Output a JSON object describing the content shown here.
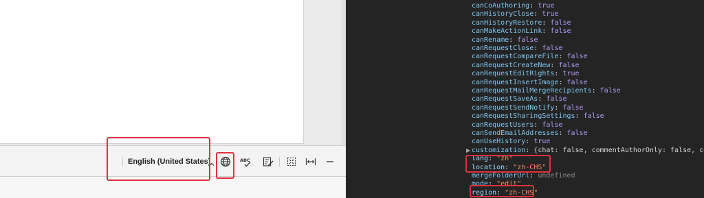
{
  "editor": {
    "status_bar": {
      "language_label": "English (United States)"
    },
    "icons": [
      "globe-icon",
      "spellcheck-icon",
      "track-changes-icon",
      "fit-page-icon",
      "fit-width-icon",
      "zoom-out-icon"
    ]
  },
  "devtools": {
    "properties": [
      {
        "key": "canCoAuthoring",
        "value": "true",
        "type": "bool"
      },
      {
        "key": "canHistoryClose",
        "value": "true",
        "type": "bool"
      },
      {
        "key": "canHistoryRestore",
        "value": "false",
        "type": "bool"
      },
      {
        "key": "canMakeActionLink",
        "value": "false",
        "type": "bool"
      },
      {
        "key": "canRename",
        "value": "false",
        "type": "bool"
      },
      {
        "key": "canRequestClose",
        "value": "false",
        "type": "bool"
      },
      {
        "key": "canRequestCompareFile",
        "value": "false",
        "type": "bool"
      },
      {
        "key": "canRequestCreateNew",
        "value": "false",
        "type": "bool"
      },
      {
        "key": "canRequestEditRights",
        "value": "true",
        "type": "bool"
      },
      {
        "key": "canRequestInsertImage",
        "value": "false",
        "type": "bool"
      },
      {
        "key": "canRequestMailMergeRecipients",
        "value": "false",
        "type": "bool"
      },
      {
        "key": "canRequestSaveAs",
        "value": "false",
        "type": "bool"
      },
      {
        "key": "canRequestSendNotify",
        "value": "false",
        "type": "bool"
      },
      {
        "key": "canRequestSharingSettings",
        "value": "false",
        "type": "bool"
      },
      {
        "key": "canRequestUsers",
        "value": "false",
        "type": "bool"
      },
      {
        "key": "canSendEmailAddresses",
        "value": "false",
        "type": "bool"
      },
      {
        "key": "canUseHistory",
        "value": "true",
        "type": "bool"
      },
      {
        "key": "customization",
        "value": "{chat: false, commentAuthorOnly: false, comment",
        "type": "object"
      },
      {
        "key": "lang",
        "value": "\"zh\"",
        "type": "string"
      },
      {
        "key": "location",
        "value": "\"zh-CHS\"",
        "type": "string"
      },
      {
        "key": "mergeFolderUrl",
        "value": "undefined",
        "type": "undefined"
      },
      {
        "key": "mode",
        "value": "\"edit\"",
        "type": "string"
      },
      {
        "key": "region",
        "value": "\"zh-CHS\"",
        "type": "string"
      }
    ]
  },
  "colors": {
    "highlight": "#e0303d",
    "devtools_bg": "#242424",
    "key": "#81c7f0",
    "bool": "#b39cf0",
    "string": "#f08b63"
  }
}
